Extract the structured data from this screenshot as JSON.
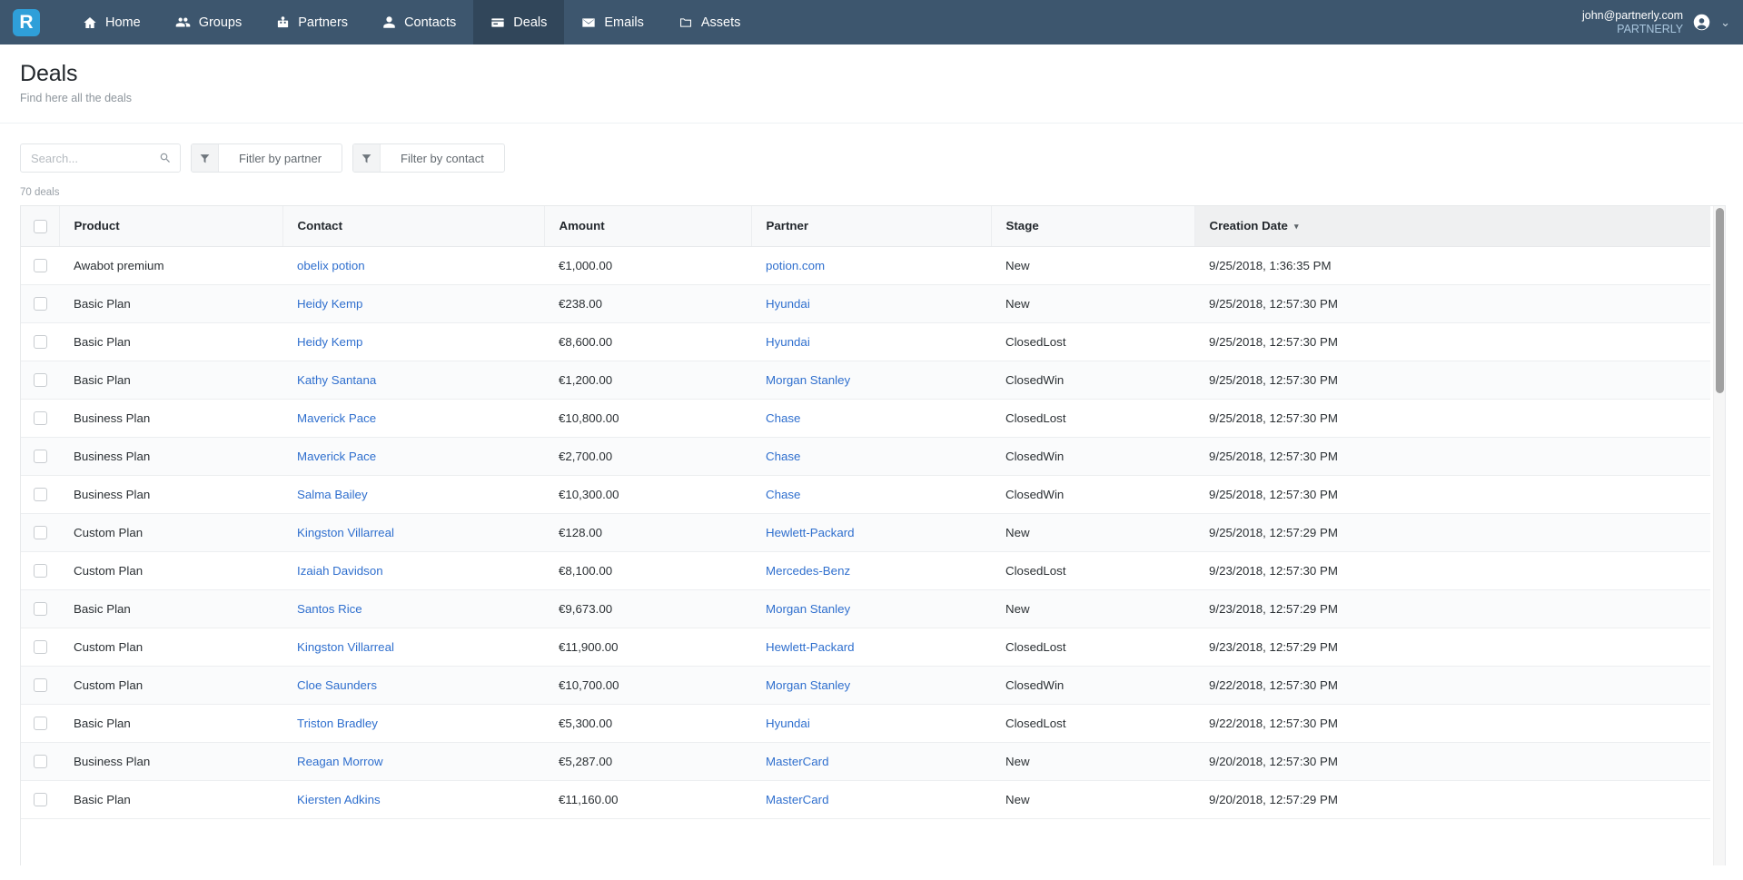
{
  "nav": {
    "logo_letter": "R",
    "items": [
      {
        "label": "Home",
        "icon": "home-icon",
        "active": false
      },
      {
        "label": "Groups",
        "icon": "groups-icon",
        "active": false
      },
      {
        "label": "Partners",
        "icon": "partners-icon",
        "active": false
      },
      {
        "label": "Contacts",
        "icon": "contacts-icon",
        "active": false
      },
      {
        "label": "Deals",
        "icon": "deals-icon",
        "active": true
      },
      {
        "label": "Emails",
        "icon": "emails-icon",
        "active": false
      },
      {
        "label": "Assets",
        "icon": "assets-icon",
        "active": false
      }
    ],
    "user_email": "john@partnerly.com",
    "user_org": "PARTNERLY",
    "avatar_icon": "user-avatar-icon",
    "caret_icon": "chevron-down-icon",
    "bar_color": "#3d566e",
    "active_color": "#31465a",
    "logo_color": "#2f9fd9"
  },
  "page": {
    "title": "Deals",
    "subtitle": "Find here all the deals"
  },
  "toolbar": {
    "search_value": "",
    "search_placeholder": "Search...",
    "search_icon": "search-icon",
    "filter_partner_label": "Fitler by partner",
    "filter_contact_label": "Filter by contact",
    "filter_icon": "funnel-icon"
  },
  "table": {
    "count_label": "70 deals",
    "sort_column": "Creation Date",
    "sort_direction": "desc",
    "sort_caret": "▾",
    "columns": [
      "Product",
      "Contact",
      "Amount",
      "Partner",
      "Stage",
      "Creation Date"
    ],
    "link_color": "#2f6fce",
    "rows": [
      {
        "product": "Awabot premium",
        "contact": "obelix potion",
        "amount": "€1,000.00",
        "partner": "potion.com",
        "stage": "New",
        "date": "9/25/2018, 1:36:35 PM"
      },
      {
        "product": "Basic Plan",
        "contact": "Heidy Kemp",
        "amount": "€238.00",
        "partner": "Hyundai",
        "stage": "New",
        "date": "9/25/2018, 12:57:30 PM"
      },
      {
        "product": "Basic Plan",
        "contact": "Heidy Kemp",
        "amount": "€8,600.00",
        "partner": "Hyundai",
        "stage": "ClosedLost",
        "date": "9/25/2018, 12:57:30 PM"
      },
      {
        "product": "Basic Plan",
        "contact": "Kathy Santana",
        "amount": "€1,200.00",
        "partner": "Morgan Stanley",
        "stage": "ClosedWin",
        "date": "9/25/2018, 12:57:30 PM"
      },
      {
        "product": "Business Plan",
        "contact": "Maverick Pace",
        "amount": "€10,800.00",
        "partner": "Chase",
        "stage": "ClosedLost",
        "date": "9/25/2018, 12:57:30 PM"
      },
      {
        "product": "Business Plan",
        "contact": "Maverick Pace",
        "amount": "€2,700.00",
        "partner": "Chase",
        "stage": "ClosedWin",
        "date": "9/25/2018, 12:57:30 PM"
      },
      {
        "product": "Business Plan",
        "contact": "Salma Bailey",
        "amount": "€10,300.00",
        "partner": "Chase",
        "stage": "ClosedWin",
        "date": "9/25/2018, 12:57:30 PM"
      },
      {
        "product": "Custom Plan",
        "contact": "Kingston Villarreal",
        "amount": "€128.00",
        "partner": "Hewlett-Packard",
        "stage": "New",
        "date": "9/25/2018, 12:57:29 PM"
      },
      {
        "product": "Custom Plan",
        "contact": "Izaiah Davidson",
        "amount": "€8,100.00",
        "partner": "Mercedes-Benz",
        "stage": "ClosedLost",
        "date": "9/23/2018, 12:57:30 PM"
      },
      {
        "product": "Basic Plan",
        "contact": "Santos Rice",
        "amount": "€9,673.00",
        "partner": "Morgan Stanley",
        "stage": "New",
        "date": "9/23/2018, 12:57:29 PM"
      },
      {
        "product": "Custom Plan",
        "contact": "Kingston Villarreal",
        "amount": "€11,900.00",
        "partner": "Hewlett-Packard",
        "stage": "ClosedLost",
        "date": "9/23/2018, 12:57:29 PM"
      },
      {
        "product": "Custom Plan",
        "contact": "Cloe Saunders",
        "amount": "€10,700.00",
        "partner": "Morgan Stanley",
        "stage": "ClosedWin",
        "date": "9/22/2018, 12:57:30 PM"
      },
      {
        "product": "Basic Plan",
        "contact": "Triston Bradley",
        "amount": "€5,300.00",
        "partner": "Hyundai",
        "stage": "ClosedLost",
        "date": "9/22/2018, 12:57:30 PM"
      },
      {
        "product": "Business Plan",
        "contact": "Reagan Morrow",
        "amount": "€5,287.00",
        "partner": "MasterCard",
        "stage": "New",
        "date": "9/20/2018, 12:57:30 PM"
      },
      {
        "product": "Basic Plan",
        "contact": "Kiersten Adkins",
        "amount": "€11,160.00",
        "partner": "MasterCard",
        "stage": "New",
        "date": "9/20/2018, 12:57:29 PM"
      }
    ]
  }
}
